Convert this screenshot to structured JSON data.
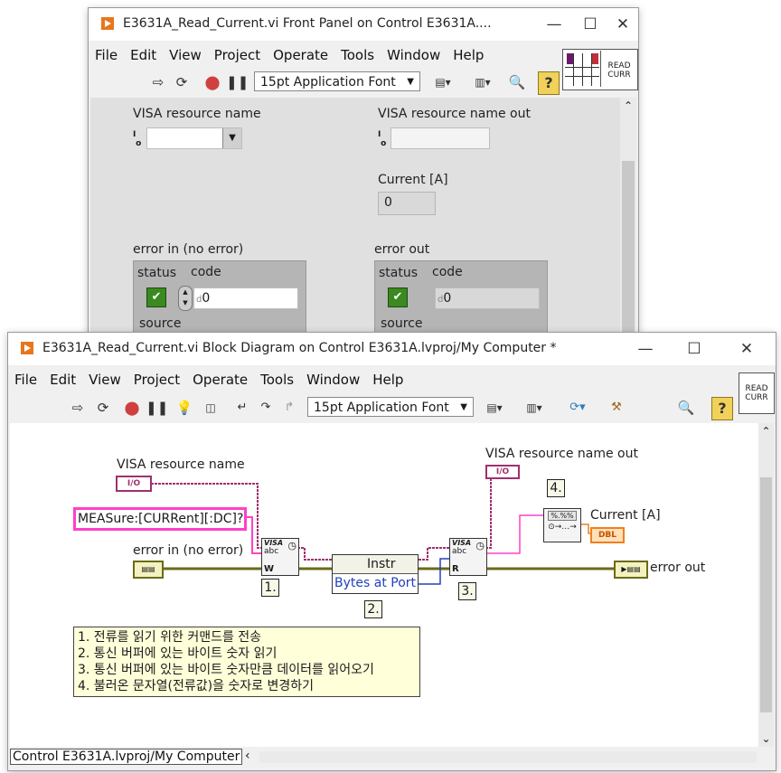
{
  "front_panel": {
    "title": "E3631A_Read_Current.vi Front Panel on Control E3631A....",
    "menu": [
      "File",
      "Edit",
      "View",
      "Project",
      "Operate",
      "Tools",
      "Window",
      "Help"
    ],
    "font_select": "15pt Application Font",
    "read_icon": [
      "READ",
      "CURR"
    ],
    "visa_in_label": "VISA resource name",
    "visa_out_label": "VISA resource name out",
    "io_glyph": "I/O",
    "current_label": "Current [A]",
    "current_value": "0",
    "error_in_label": "error in (no error)",
    "error_out_label": "error out",
    "status_label": "status",
    "code_label": "code",
    "code_value": "0",
    "source_label": "source",
    "num_type_glyph": "d"
  },
  "block_diagram": {
    "title": "E3631A_Read_Current.vi Block Diagram on Control E3631A.lvproj/My Computer *",
    "menu": [
      "File",
      "Edit",
      "View",
      "Project",
      "Operate",
      "Tools",
      "Window",
      "Help"
    ],
    "font_select": "15pt Application Font",
    "read_icon": [
      "READ",
      "CURR"
    ],
    "visa_in_label": "VISA resource name",
    "visa_out_label": "VISA resource name out",
    "io_terminal": "I/O",
    "command_constant": "MEASure:[CURRent][:DC]?",
    "error_in_label": "error in (no error)",
    "error_out_label": "error out",
    "current_label": "Current [A]",
    "dbl_terminal": "DBL",
    "visa_node_label": "VISA",
    "visa_write_letter": "W",
    "visa_read_letter": "R",
    "abc_label": "abc",
    "property_node_class": "Instr",
    "property_node_item": "Bytes at Port",
    "scan_node_label": "%.%%",
    "step_labels": [
      "1.",
      "2.",
      "3.",
      "4."
    ],
    "comment_lines": [
      "1. 전류를 읽기 위한 커맨드를 전송",
      "2. 통신 버퍼에 있는 바이트 숫자 읽기",
      "3. 통신 버퍼에 있는 바이트 숫자만큼 데이터를 읽어오기",
      "4. 불러온 문자열(전류값)을 숫자로 변경하기"
    ],
    "status_text": "Control E3631A.lvproj/My Computer"
  },
  "colors": {
    "visa_wire": "#a0306e",
    "string_wire": "#ff40c8",
    "error_wire": "#6b6b1a",
    "int_wire": "#2040c0",
    "dbl_wire": "#f08020",
    "labview_orange": "#e8761c"
  }
}
